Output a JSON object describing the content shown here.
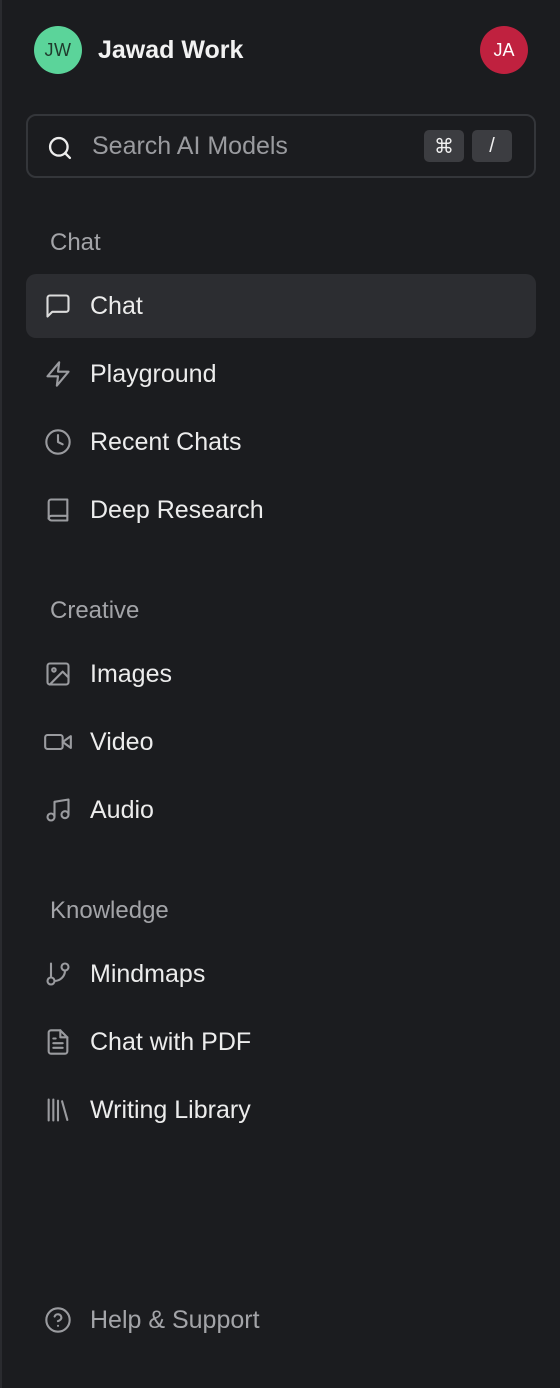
{
  "workspace": {
    "initials": "JW",
    "name": "Jawad Work",
    "avatar_color": "#5bd49a"
  },
  "user": {
    "initials": "JA",
    "avatar_color": "#c0213f"
  },
  "search": {
    "placeholder": "Search AI Models",
    "shortcut_key_1": "⌘",
    "shortcut_key_2": "/"
  },
  "sections": {
    "chat": {
      "title": "Chat",
      "items": [
        {
          "label": "Chat",
          "icon": "message-square-icon",
          "active": true
        },
        {
          "label": "Playground",
          "icon": "lightning-icon"
        },
        {
          "label": "Recent Chats",
          "icon": "clock-icon"
        },
        {
          "label": "Deep Research",
          "icon": "book-icon"
        }
      ]
    },
    "creative": {
      "title": "Creative",
      "items": [
        {
          "label": "Images",
          "icon": "image-icon"
        },
        {
          "label": "Video",
          "icon": "video-icon"
        },
        {
          "label": "Audio",
          "icon": "music-note-icon"
        }
      ]
    },
    "knowledge": {
      "title": "Knowledge",
      "items": [
        {
          "label": "Mindmaps",
          "icon": "git-branch-icon"
        },
        {
          "label": "Chat with PDF",
          "icon": "file-text-icon"
        },
        {
          "label": "Writing Library",
          "icon": "library-icon"
        }
      ]
    }
  },
  "footer": {
    "help_label": "Help & Support",
    "help_icon": "help-circle-icon"
  },
  "colors": {
    "background": "#1b1c1f",
    "active_item_bg": "#2c2d31",
    "muted_text": "#a3a4a8"
  }
}
